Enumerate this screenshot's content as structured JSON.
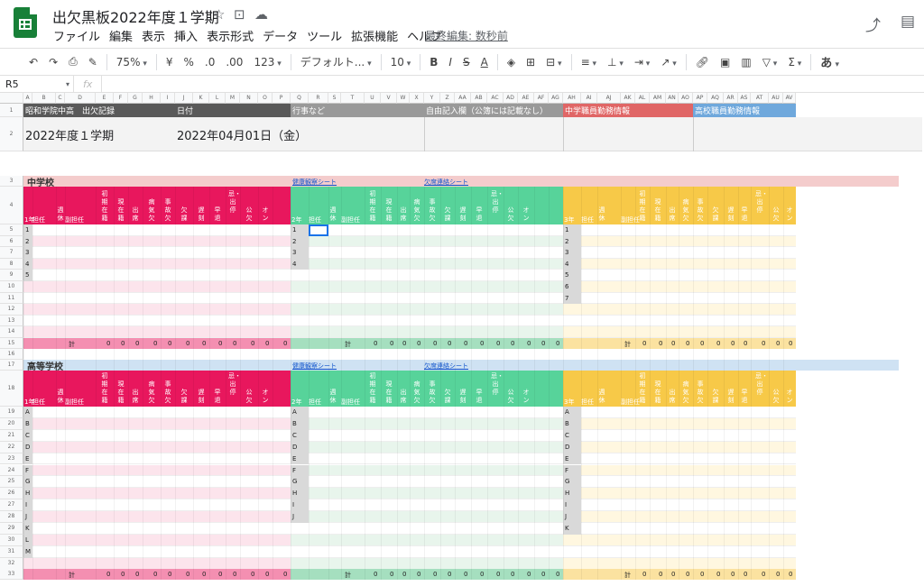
{
  "doc": {
    "title": "出欠黒板2022年度１学期",
    "last_edit": "最終編集: 数秒前"
  },
  "menu": [
    "ファイル",
    "編集",
    "表示",
    "挿入",
    "表示形式",
    "データ",
    "ツール",
    "拡張機能",
    "ヘルプ"
  ],
  "toolbar": {
    "zoom": "75%",
    "currency": "¥",
    "percent": "%",
    "dec_less": ".0",
    "dec_more": ".00",
    "format123": "123",
    "font": "デフォルト...",
    "font_size": "10",
    "bold": "B",
    "italic": "I",
    "strike": "S",
    "textcolor": "A",
    "ime": "あ"
  },
  "formula_bar": {
    "cell_ref": "R5",
    "fx": "fx",
    "value": ""
  },
  "columns": [
    "A",
    "B",
    "C",
    "D",
    "E",
    "F",
    "G",
    "H",
    "I",
    "J",
    "K",
    "L",
    "M",
    "N",
    "O",
    "P",
    "Q",
    "R",
    "S",
    "T",
    "U",
    "V",
    "W",
    "X",
    "Y",
    "Z",
    "AA",
    "AB",
    "AC",
    "AD",
    "AE",
    "AF",
    "AG",
    "AH",
    "AI",
    "AJ",
    "AK",
    "AL",
    "AM",
    "AN",
    "AO",
    "AP",
    "AQ",
    "AR",
    "AS",
    "AT",
    "AU",
    "AV"
  ],
  "rows": [
    "1",
    "2",
    "3",
    "4",
    "5",
    "6",
    "7",
    "8",
    "9",
    "10",
    "11",
    "12",
    "13",
    "14",
    "15",
    "16",
    "17",
    "18",
    "19",
    "20",
    "21",
    "22",
    "23",
    "24",
    "25",
    "26",
    "27",
    "28",
    "29",
    "30",
    "31",
    "32",
    "33"
  ],
  "header": {
    "school": "昭和学院中高　出欠記録",
    "date_label": "日付",
    "events_label": "行事など",
    "free_label": "自由記入欄（公簿には記載なし）",
    "jh_staff": "中学職員勤務情報",
    "hs_staff": "高校職員勤務情報",
    "term": "2022年度１学期",
    "date": "2022年04月01日（金）"
  },
  "sections": {
    "junior": "中学校",
    "senior": "高等学校",
    "health_link": "健康観察シート",
    "absence_link": "欠席連絡シート"
  },
  "col_headers": {
    "grade1": "1年",
    "grade2": "2年",
    "grade3": "3年",
    "homeroom": "担任",
    "off": "週休",
    "vice": "副担任",
    "stats": [
      "初期在籍",
      "現在籍",
      "出席",
      "病気欠",
      "事故欠",
      "欠課",
      "遅刻",
      "早退",
      "忌・出停",
      "公欠",
      "オン"
    ]
  },
  "total_label": "計",
  "zero": "0",
  "jh_classes": {
    "g1": [
      "1",
      "2",
      "3",
      "4",
      "5"
    ],
    "g2": [
      "1",
      "2",
      "3",
      "4"
    ],
    "g3": [
      "1",
      "2",
      "3",
      "4",
      "5",
      "6",
      "7"
    ]
  },
  "hs_classes": {
    "g1": [
      "A",
      "B",
      "C",
      "D",
      "E",
      "F",
      "G",
      "H",
      "I",
      "J",
      "K",
      "L",
      "M"
    ],
    "g2": [
      "A",
      "B",
      "C",
      "D",
      "E",
      "F",
      "G",
      "H",
      "I",
      "J"
    ],
    "g3": [
      "A",
      "B",
      "C",
      "D",
      "E",
      "F",
      "G",
      "H",
      "I",
      "J",
      "K"
    ]
  },
  "colors": {
    "pink": "#e8175d",
    "pink_light": "#fce4ec",
    "pink_total": "#f48fb1",
    "green": "#57d39a",
    "green_light": "#e8f5ec",
    "green_total": "#a5dfbf",
    "orange": "#f7c948",
    "orange_light": "#fff7e0",
    "orange_total": "#fbe2a0",
    "dark": "#595959",
    "gray": "#999999",
    "red": "#e06666",
    "blue": "#6fa8dc",
    "section_jh": "#f4cccc",
    "section_hs": "#cfe2f3"
  }
}
